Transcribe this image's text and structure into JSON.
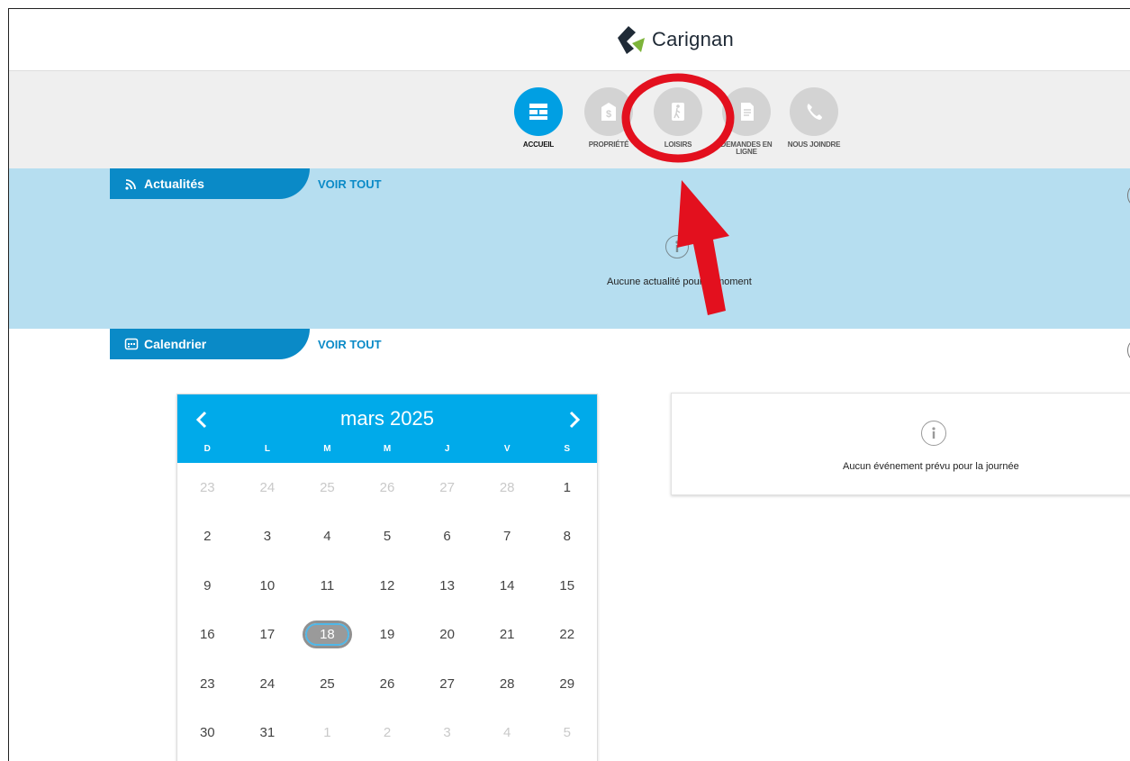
{
  "brand": {
    "name": "Carignan"
  },
  "nav": {
    "items": [
      {
        "label": "ACCUEIL",
        "icon": "grid-icon",
        "active": true
      },
      {
        "label": "PROPRIÉTÉ",
        "icon": "dollar-house-icon",
        "active": false
      },
      {
        "label": "LOISIRS",
        "icon": "hiking-icon",
        "active": false
      },
      {
        "label": "DEMANDES EN LIGNE",
        "icon": "document-icon",
        "active": false
      },
      {
        "label": "NOUS JOINDRE",
        "icon": "phone-icon",
        "active": false
      }
    ]
  },
  "news": {
    "title": "Actualités",
    "see_all": "VOIR TOUT",
    "empty": "Aucune actualité pour le moment"
  },
  "calendar_section": {
    "title": "Calendrier",
    "see_all": "VOIR TOUT"
  },
  "calendar": {
    "month": "mars 2025",
    "days_of_week": [
      "D",
      "L",
      "M",
      "M",
      "J",
      "V",
      "S"
    ],
    "weeks": [
      [
        [
          "23",
          true
        ],
        [
          "24",
          true
        ],
        [
          "25",
          true
        ],
        [
          "26",
          true
        ],
        [
          "27",
          true
        ],
        [
          "28",
          true
        ],
        [
          "1",
          false
        ]
      ],
      [
        [
          "2",
          false
        ],
        [
          "3",
          false
        ],
        [
          "4",
          false
        ],
        [
          "5",
          false
        ],
        [
          "6",
          false
        ],
        [
          "7",
          false
        ],
        [
          "8",
          false
        ]
      ],
      [
        [
          "9",
          false
        ],
        [
          "10",
          false
        ],
        [
          "11",
          false
        ],
        [
          "12",
          false
        ],
        [
          "13",
          false
        ],
        [
          "14",
          false
        ],
        [
          "15",
          false
        ]
      ],
      [
        [
          "16",
          false
        ],
        [
          "17",
          false
        ],
        [
          "18",
          false
        ],
        [
          "19",
          false
        ],
        [
          "20",
          false
        ],
        [
          "21",
          false
        ],
        [
          "22",
          false
        ]
      ],
      [
        [
          "23",
          false
        ],
        [
          "24",
          false
        ],
        [
          "25",
          false
        ],
        [
          "26",
          false
        ],
        [
          "27",
          false
        ],
        [
          "28",
          false
        ],
        [
          "29",
          false
        ]
      ],
      [
        [
          "30",
          false
        ],
        [
          "31",
          false
        ],
        [
          "1",
          true
        ],
        [
          "2",
          true
        ],
        [
          "3",
          true
        ],
        [
          "4",
          true
        ],
        [
          "5",
          true
        ]
      ]
    ],
    "selected_day": "18"
  },
  "events": {
    "empty": "Aucun événement prévu pour la journée"
  },
  "colors": {
    "accent": "#009fe3",
    "tab": "#0a8ac7",
    "news_bg": "#b6def0",
    "annotation": "#e3101e"
  }
}
